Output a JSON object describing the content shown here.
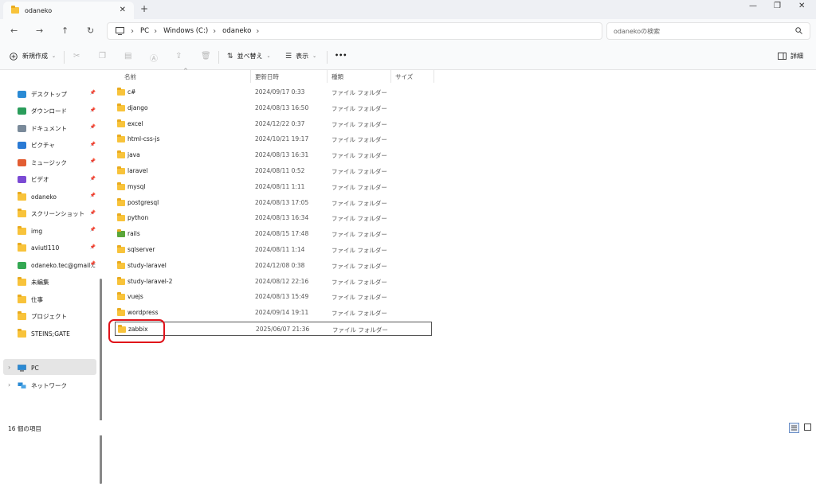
{
  "window": {
    "tab_title": "odaneko",
    "tab_close": "✕",
    "new_tab": "+",
    "minimize": "—",
    "maximize": "❐",
    "close": "✕"
  },
  "nav": {
    "back": "←",
    "forward": "→",
    "up": "↑",
    "refresh": "↻"
  },
  "address": {
    "crumbs": [
      "PC",
      "Windows (C:)",
      "odaneko"
    ],
    "search_placeholder": "odanekoの検索"
  },
  "toolbar": {
    "new_label": "新規作成",
    "sort_label": "並べ替え",
    "view_label": "表示",
    "more_label": "•••",
    "details_label": "詳細"
  },
  "sidebar": {
    "items": [
      {
        "label": "デスクトップ",
        "icon": "desktop-icon",
        "pinned": true
      },
      {
        "label": "ダウンロード",
        "icon": "download-icon",
        "pinned": true
      },
      {
        "label": "ドキュメント",
        "icon": "document-icon",
        "pinned": true
      },
      {
        "label": "ピクチャ",
        "icon": "pictures-icon",
        "pinned": true
      },
      {
        "label": "ミュージック",
        "icon": "music-icon",
        "pinned": true
      },
      {
        "label": "ビデオ",
        "icon": "video-icon",
        "pinned": true
      },
      {
        "label": "odaneko",
        "icon": "folder-icon",
        "pinned": true
      },
      {
        "label": "スクリーンショット",
        "icon": "folder-icon",
        "pinned": true
      },
      {
        "label": "img",
        "icon": "folder-icon",
        "pinned": true
      },
      {
        "label": "aviutl110",
        "icon": "folder-icon",
        "pinned": true
      },
      {
        "label": "odaneko.tec@gmail.c",
        "icon": "google-drive-icon",
        "pinned": true
      },
      {
        "label": "未編集",
        "icon": "folder-icon",
        "pinned": false
      },
      {
        "label": "仕事",
        "icon": "folder-icon",
        "pinned": false
      },
      {
        "label": "プロジェクト",
        "icon": "folder-icon",
        "pinned": false
      },
      {
        "label": "STEINS;GATE",
        "icon": "folder-icon",
        "pinned": false
      }
    ],
    "pc_label": "PC",
    "network_label": "ネットワーク"
  },
  "columns": {
    "name": "名前",
    "date": "更新日時",
    "type": "種類",
    "size": "サイズ"
  },
  "files": [
    {
      "name": "c#",
      "date": "2024/09/17 0:33",
      "type": "ファイル フォルダー"
    },
    {
      "name": "django",
      "date": "2024/08/13 16:50",
      "type": "ファイル フォルダー"
    },
    {
      "name": "excel",
      "date": "2024/12/22 0:37",
      "type": "ファイル フォルダー"
    },
    {
      "name": "html-css-js",
      "date": "2024/10/21 19:17",
      "type": "ファイル フォルダー"
    },
    {
      "name": "java",
      "date": "2024/08/13 16:31",
      "type": "ファイル フォルダー"
    },
    {
      "name": "laravel",
      "date": "2024/08/11 0:52",
      "type": "ファイル フォルダー"
    },
    {
      "name": "mysql",
      "date": "2024/08/11 1:11",
      "type": "ファイル フォルダー"
    },
    {
      "name": "postgresql",
      "date": "2024/08/13 17:05",
      "type": "ファイル フォルダー"
    },
    {
      "name": "python",
      "date": "2024/08/13 16:34",
      "type": "ファイル フォルダー"
    },
    {
      "name": "rails",
      "date": "2024/08/15 17:48",
      "type": "ファイル フォルダー"
    },
    {
      "name": "sqlserver",
      "date": "2024/08/11 1:14",
      "type": "ファイル フォルダー"
    },
    {
      "name": "study-laravel",
      "date": "2024/12/08 0:38",
      "type": "ファイル フォルダー"
    },
    {
      "name": "study-laravel-2",
      "date": "2024/08/12 22:16",
      "type": "ファイル フォルダー"
    },
    {
      "name": "vuejs",
      "date": "2024/08/13 15:49",
      "type": "ファイル フォルダー"
    },
    {
      "name": "wordpress",
      "date": "2024/09/14 19:11",
      "type": "ファイル フォルダー"
    },
    {
      "name": "zabbix",
      "date": "2025/06/07 21:36",
      "type": "ファイル フォルダー"
    }
  ],
  "status": {
    "item_count": "16 個の項目"
  },
  "colors": {
    "folder": "#f8c33b",
    "highlight": "#e0121a"
  }
}
